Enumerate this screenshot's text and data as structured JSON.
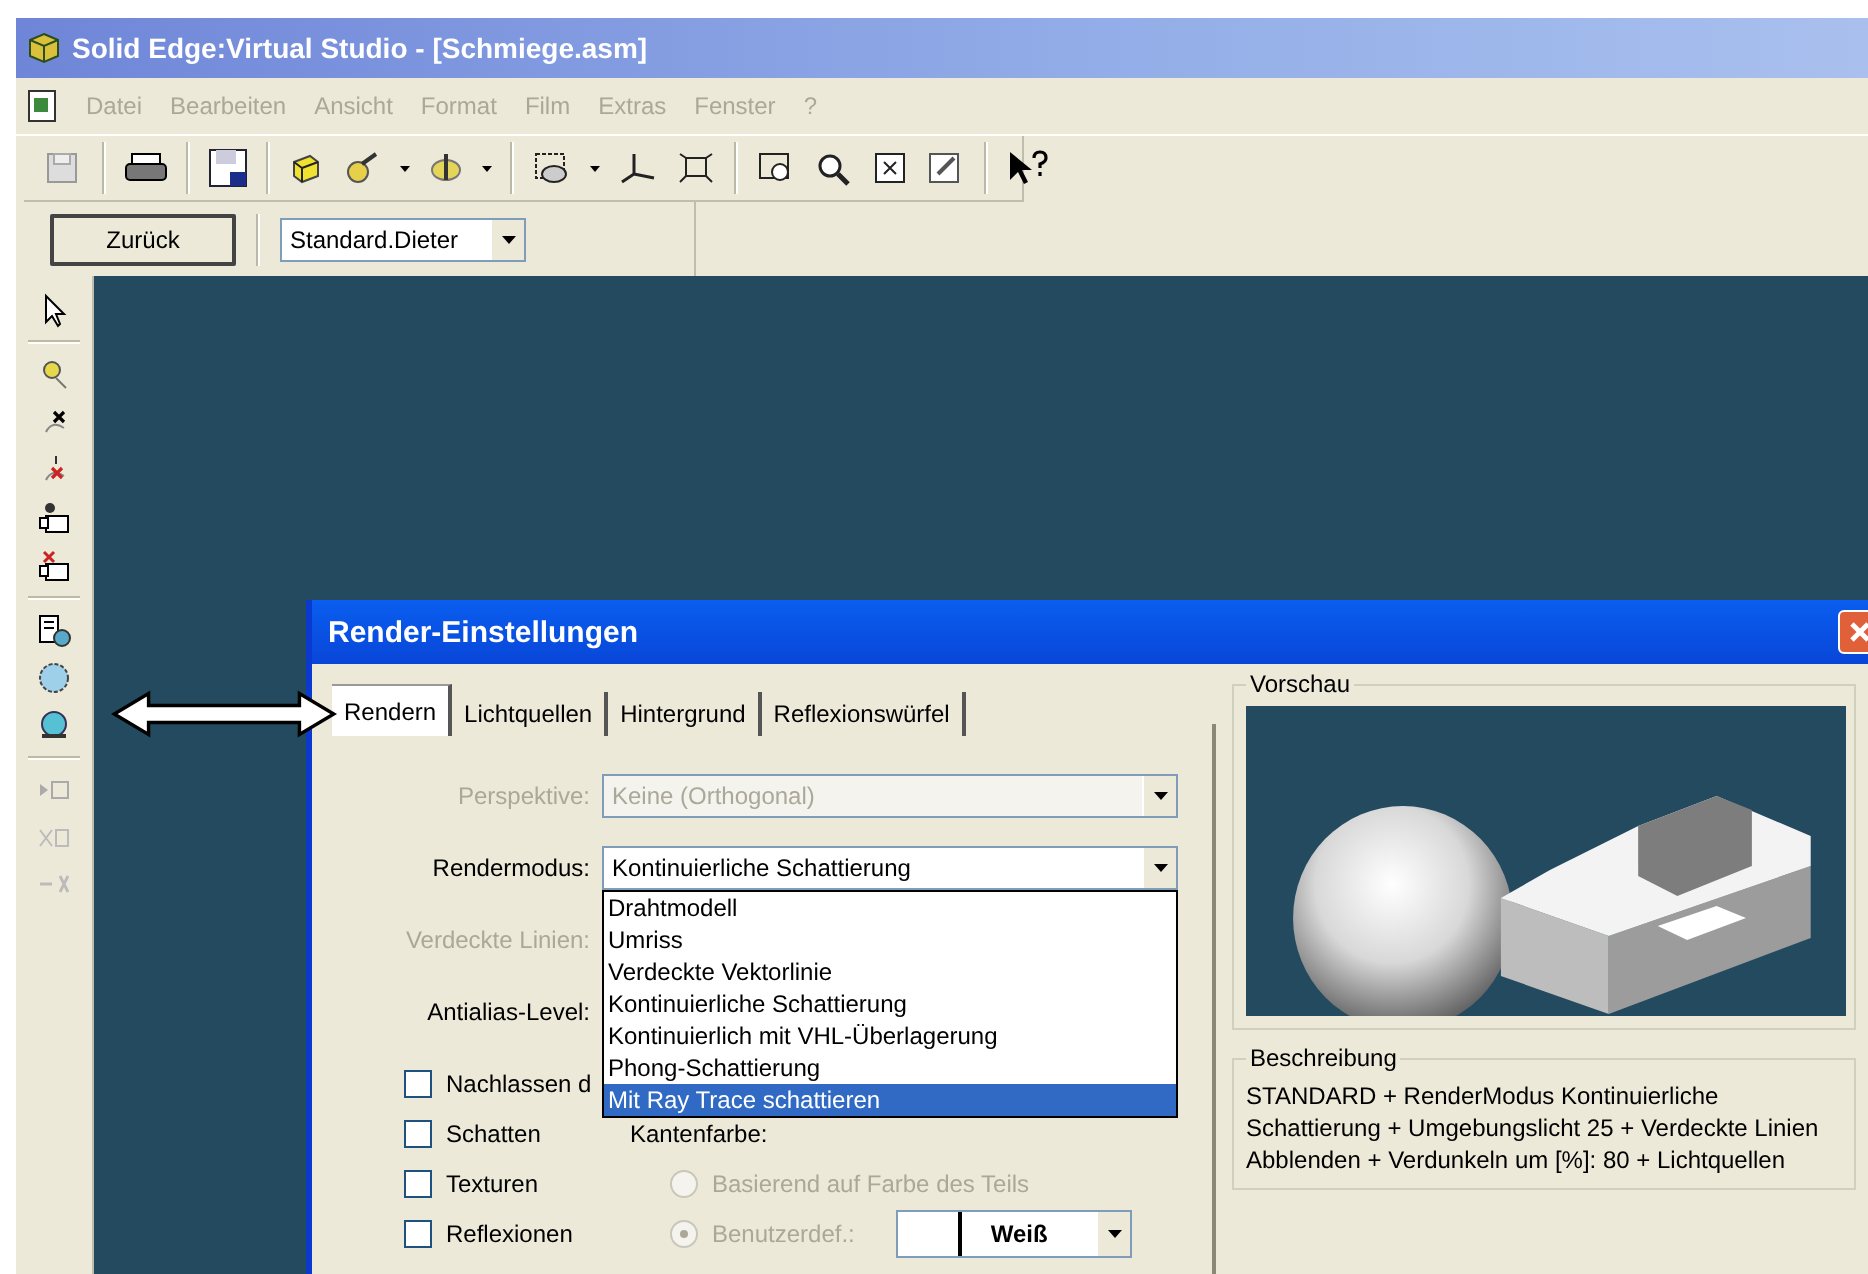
{
  "window": {
    "title": "Solid Edge:Virtual Studio - [Schmiege.asm]"
  },
  "menu": [
    {
      "label": "Datei",
      "disabled": true
    },
    {
      "label": "Bearbeiten",
      "disabled": true
    },
    {
      "label": "Ansicht",
      "disabled": true
    },
    {
      "label": "Format",
      "disabled": true
    },
    {
      "label": "Film",
      "disabled": true
    },
    {
      "label": "Extras",
      "disabled": true
    },
    {
      "label": "Fenster",
      "disabled": true
    },
    {
      "label": "?",
      "disabled": true
    }
  ],
  "style_bar": {
    "back_button": "Zurück",
    "style_value": "Standard.Dieter"
  },
  "dialog": {
    "title": "Render-Einstellungen",
    "tabs": [
      {
        "label": "Rendern",
        "selected": true
      },
      {
        "label": "Lichtquellen",
        "selected": false
      },
      {
        "label": "Hintergrund",
        "selected": false
      },
      {
        "label": "Reflexionswürfel",
        "selected": false
      }
    ],
    "fields": [
      {
        "label": "Perspektive:",
        "value": "Keine (Orthogonal)",
        "disabled": true
      },
      {
        "label": "Rendermodus:",
        "value": "Kontinuierliche Schattierung",
        "disabled": false
      },
      {
        "label": "Verdeckte Linien:",
        "disabled": true
      },
      {
        "label": "Antialias-Level:",
        "disabled": false
      }
    ],
    "render_mode_options": [
      {
        "label": "Drahtmodell",
        "selected": false
      },
      {
        "label": "Umriss",
        "selected": false
      },
      {
        "label": "Verdeckte Vektorlinie",
        "selected": false
      },
      {
        "label": "Kontinuierliche Schattierung",
        "selected": false
      },
      {
        "label": "Kontinuierlich mit VHL-Überlagerung",
        "selected": false
      },
      {
        "label": "Phong-Schattierung",
        "selected": false
      },
      {
        "label": "Mit Ray Trace schattieren",
        "selected": true
      }
    ],
    "checkboxes": [
      {
        "label": "Nachlassen d",
        "checked": false
      },
      {
        "label": "Schatten",
        "checked": false
      },
      {
        "label": "Texturen",
        "checked": false
      },
      {
        "label": "Reflexionen",
        "checked": false
      }
    ],
    "edge_color": {
      "label": "Kantenfarbe:",
      "options": [
        {
          "label": "Basierend auf Farbe des Teils",
          "selected": false,
          "disabled": true
        },
        {
          "label": "Benutzerdef.:",
          "selected": true,
          "disabled": true
        }
      ],
      "color_value": "Weiß"
    },
    "preview": {
      "title": "Vorschau"
    },
    "description": {
      "title": "Beschreibung",
      "text": "STANDARD + RenderModus Kontinuierliche Schattierung + Umgebungslicht 25 + Verdeckte Linien Abblenden + Verdunkeln um [%]: 80 + Lichtquellen"
    }
  }
}
